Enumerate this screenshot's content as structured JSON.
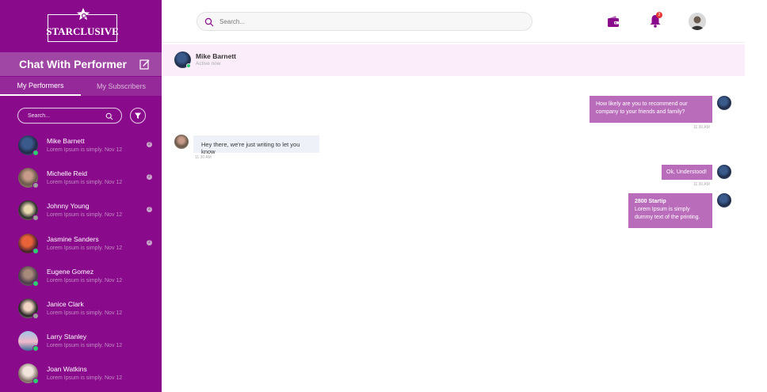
{
  "brand": {
    "logo_text": "STARCLUSIVE"
  },
  "sidebar": {
    "title": "Chat With Performer",
    "tabs": [
      {
        "label": "My Performers",
        "active": true
      },
      {
        "label": "My Subscribers",
        "active": false
      }
    ],
    "search_placeholder": "Search...",
    "contacts": [
      {
        "name": "Mike Barnett",
        "preview": "Lorem Ipsum is simply. Nov 12",
        "badge": "2",
        "online": true
      },
      {
        "name": "Michelle Reid",
        "preview": "Lorem Ipsum is simply. Nov 12",
        "badge": "2",
        "online": false
      },
      {
        "name": "Johnny Young",
        "preview": "Lorem Ipsum is simply. Nov 12",
        "badge": "2",
        "online": false
      },
      {
        "name": "Jasmine Sanders",
        "preview": "Lorem Ipsum is simply. Nov 12",
        "badge": "2",
        "online": true
      },
      {
        "name": "Eugene Gomez",
        "preview": "Lorem Ipsum is simply. Nov 12",
        "badge": "",
        "online": true
      },
      {
        "name": "Janice Clark",
        "preview": "Lorem Ipsum is simply. Nov 12",
        "badge": "",
        "online": false
      },
      {
        "name": "Larry Stanley",
        "preview": "Lorem Ipsum is simply. Nov 12",
        "badge": "",
        "online": true
      },
      {
        "name": "Joan Watkins",
        "preview": "Lorem Ipsum is simply. Nov 12",
        "badge": "",
        "online": true
      }
    ]
  },
  "topbar": {
    "search_placeholder": "Search...",
    "notification_count": "2"
  },
  "conversation": {
    "name": "Mike Barnett",
    "status": "Active now",
    "messages": [
      {
        "line1": "How likely are you to recommend our",
        "line2": "company to your friends and family?",
        "time": "11:30 AM"
      },
      {
        "text": "Hey there, we're just writing to let you know",
        "time": "11:30 AM"
      },
      {
        "text": "Ok, Understood!",
        "time": "11:30 AM"
      },
      {
        "title": "2800 Startip",
        "line1": "Lorem Ipsum is simply",
        "line2": "dummy text of the printing."
      }
    ]
  },
  "colors": {
    "sidebar_bg": "#8a0a8c",
    "accent": "#b86cba",
    "online": "#2ecc71",
    "offline": "#9e9e9e"
  }
}
